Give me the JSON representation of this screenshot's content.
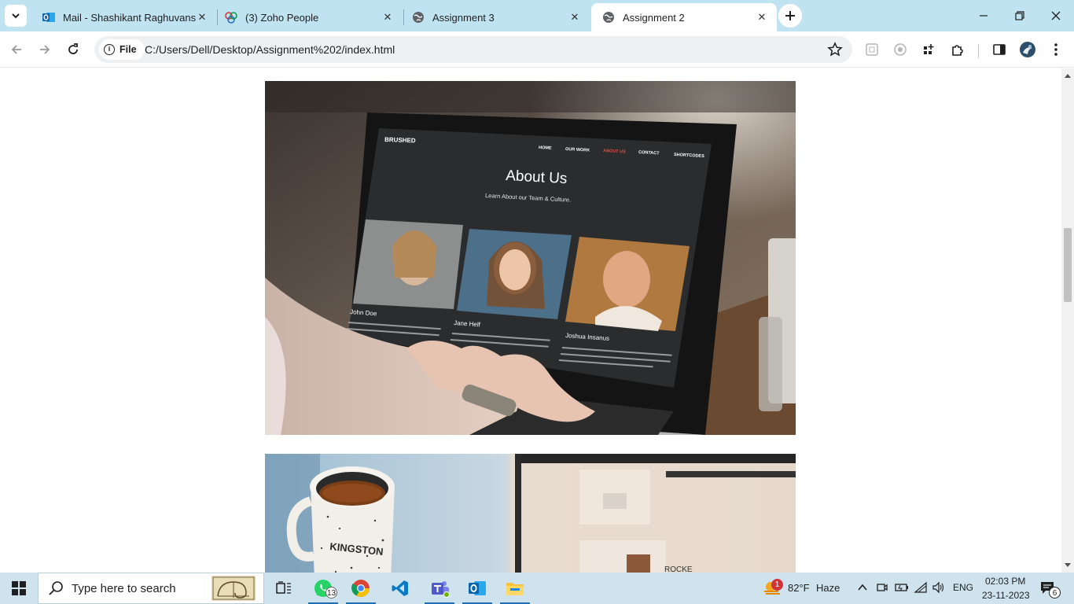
{
  "browser": {
    "tabs": [
      {
        "title": "Mail - Shashikant Raghuvanshi",
        "icon": "outlook-icon",
        "active": false
      },
      {
        "title": "(3) Zoho People",
        "icon": "zoho-icon",
        "active": false
      },
      {
        "title": "Assignment 3",
        "icon": "globe-icon",
        "active": false
      },
      {
        "title": "Assignment 2",
        "icon": "globe-icon",
        "active": true
      }
    ],
    "address": {
      "scheme_chip": "File",
      "url": "C:/Users/Dell/Desktop/Assignment%202/index.html"
    }
  },
  "page": {
    "images": [
      {
        "name": "laptop-about-us-photo",
        "description_site": "BRUSHED"
      },
      {
        "name": "coffee-mug-laptop-photo"
      }
    ],
    "laptop_screen": {
      "brand": "BRUSHED",
      "nav": [
        "HOME",
        "OUR WORK",
        "ABOUT US",
        "CONTACT",
        "SHORTCODES"
      ],
      "heading": "About Us",
      "subheading": "Learn About our Team & Culture.",
      "members": [
        "John Doe",
        "Jane Helf",
        "Joshua Insanus"
      ]
    },
    "mug_text": "KINGSTON"
  },
  "taskbar": {
    "search_placeholder": "Type here to search",
    "whatsapp_badge": "13",
    "weather_temp": "82°F",
    "weather_desc": "Haze",
    "weather_badge": "1",
    "language": "ENG",
    "time": "02:03 PM",
    "date": "23-11-2023",
    "notification_count": "6"
  },
  "colors": {
    "tabstrip": "#bfe3f0",
    "taskbar": "#cfe3ee",
    "accent": "#1f6fb2"
  }
}
